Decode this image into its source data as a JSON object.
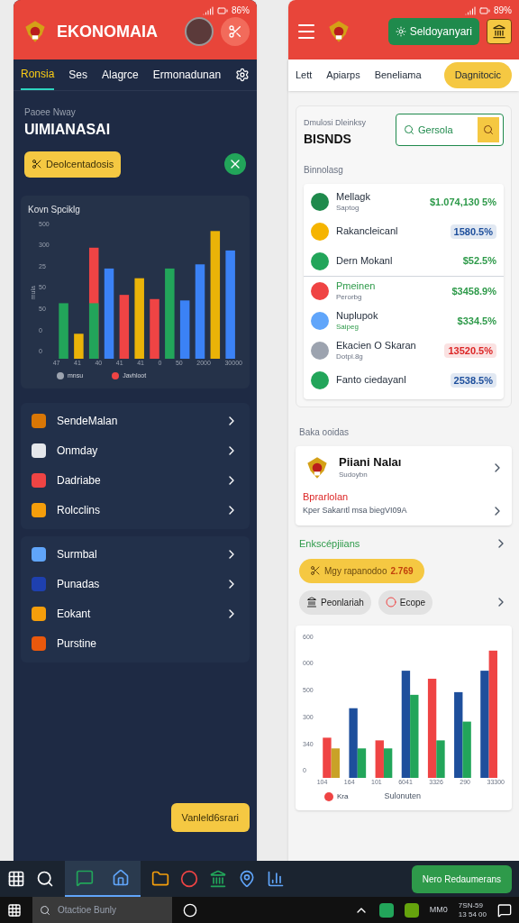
{
  "left_app": {
    "status": "86%",
    "title": "EKONOMAIA",
    "tabs": [
      {
        "label": "Ronsia",
        "selected": true
      },
      {
        "label": "Ses",
        "selected": false
      },
      {
        "label": "Alagrce",
        "selected": false
      },
      {
        "label": "Ermonadunan",
        "selected": false
      }
    ],
    "subtitle": "Paoee Nway",
    "heading": "UIMIANASAI",
    "action_button": "Deolcentadosis",
    "chart": {
      "title": "Kovn Spciklg",
      "ylabel": "mula",
      "y_labels": [
        "500",
        "300",
        "25",
        "50",
        "50",
        "0",
        "0"
      ],
      "x_labels": [
        "47",
        "41",
        "40",
        "41",
        "41",
        "0",
        "50",
        "2000",
        "30000"
      ],
      "legend": [
        {
          "label": "mnsu",
          "color": "#9ca3af"
        },
        {
          "label": "Javhloot",
          "color": "#ef4444"
        }
      ]
    },
    "menu_groups": [
      [
        {
          "label": "SendeMalan",
          "chevron": true
        },
        {
          "label": "Onmday",
          "chevron": true
        },
        {
          "label": "Dadriabe",
          "chevron": true
        },
        {
          "label": "Rolcclins",
          "chevron": true
        }
      ],
      [
        {
          "label": "Surmbal",
          "chevron": true
        },
        {
          "label": "Punadas",
          "chevron": true
        },
        {
          "label": "Eokant",
          "chevron": true
        },
        {
          "label": "Purstine",
          "chevron": false
        }
      ]
    ],
    "bottom_button": "Vanleld6srari"
  },
  "right_app": {
    "status": "89%",
    "header_button": "Seldoyanyari",
    "tabs": [
      {
        "label": "Lett",
        "selected": false
      },
      {
        "label": "Apiarps",
        "selected": false
      },
      {
        "label": "Beneliama",
        "selected": false
      },
      {
        "label": "Dagnitocic",
        "selected": true
      }
    ],
    "subtitle": "Dmulosi Dleinksy",
    "heading": "BISNDS",
    "search": {
      "value": "Gersola"
    },
    "list_label": "Binnolasg",
    "items": [
      {
        "name": "Mellagk",
        "sub": "Saptog",
        "value": "$1.074,130 5%",
        "kind": "text",
        "color": "#2e9a4a",
        "divider": false,
        "name_highlight": false,
        "sub_highlight": false
      },
      {
        "name": "Rakancleicanl",
        "value": "1580.5%",
        "kind": "pill",
        "color": "#1e4f9c",
        "divider": false,
        "name_highlight": false
      },
      {
        "name": "Dern Mokanl",
        "value": "$52.5%",
        "kind": "text",
        "color": "#2e9a4a",
        "divider": true,
        "name_highlight": false
      },
      {
        "name": "Pmeinen",
        "sub": "Perorbg",
        "value": "$3458.9%",
        "kind": "text",
        "color": "#2e9a4a",
        "divider": false,
        "name_highlight": true,
        "sub_highlight": false
      },
      {
        "name": "Nuplupok",
        "sub": "Saipeg",
        "value": "$334.5%",
        "kind": "text",
        "color": "#2e9a4a",
        "divider": false,
        "name_highlight": false,
        "sub_highlight": true
      },
      {
        "name": "Ekacien O Skaran",
        "sub": "Dotpl.8g",
        "value": "13520.5%",
        "kind": "pill",
        "color": "#dc2626",
        "divider": false,
        "name_highlight": false,
        "sub_highlight": false
      },
      {
        "name": "Fanto ciedayanl",
        "value": "2538.5%",
        "kind": "pill",
        "color": "#1e4f9c",
        "divider": false,
        "name_highlight": false
      }
    ],
    "section_label": "Baka ooidas",
    "profile": {
      "name": "Piiani Nalaı",
      "sub": "Sudoybn",
      "alert_title": "Bprarlolan",
      "alert_text": "Kper Sakarıtl msa biegVI09A"
    },
    "link": "Enkscépjiians",
    "promo": {
      "label": "Mgy rapanodoo",
      "value": "2.769"
    },
    "chips": [
      "Peonlariah",
      "Ecope"
    ],
    "chart": {
      "y_labels": [
        "600",
        "000",
        "500",
        "300",
        "340",
        "0"
      ],
      "x_labels": [
        "104",
        "164",
        "101",
        "6041",
        "3326",
        "290",
        "33300"
      ],
      "legend": [
        {
          "label": "Kra",
          "color": "#ef4444"
        }
      ],
      "caption": "Sulonuten"
    }
  },
  "taskbar": {
    "pinned_button": "Nero Redaumerans",
    "search": {
      "placeholder": "Otactioe Bunly"
    },
    "tray_text": "MM0",
    "time": "7SN-59",
    "date": "13 54 00"
  }
}
